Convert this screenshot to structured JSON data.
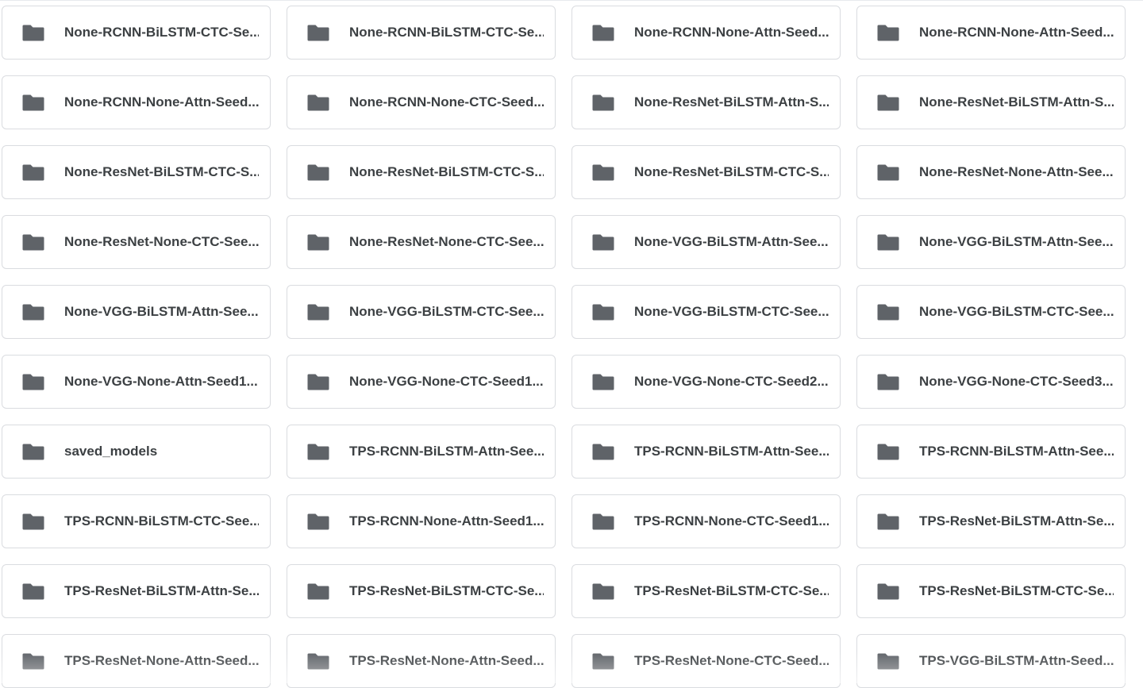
{
  "colors": {
    "folder_icon": "#5f6368",
    "text": "#3c4043",
    "card_border": "#dadce0",
    "background": "#ffffff"
  },
  "folders": [
    {
      "name": "None-RCNN-BiLSTM-CTC-Se...",
      "icon": "folder-icon"
    },
    {
      "name": "None-RCNN-BiLSTM-CTC-Se...",
      "icon": "folder-icon"
    },
    {
      "name": "None-RCNN-None-Attn-Seed...",
      "icon": "folder-icon"
    },
    {
      "name": "None-RCNN-None-Attn-Seed...",
      "icon": "folder-icon"
    },
    {
      "name": "None-RCNN-None-Attn-Seed...",
      "icon": "folder-icon"
    },
    {
      "name": "None-RCNN-None-CTC-Seed...",
      "icon": "folder-icon"
    },
    {
      "name": "None-ResNet-BiLSTM-Attn-S...",
      "icon": "folder-icon"
    },
    {
      "name": "None-ResNet-BiLSTM-Attn-S...",
      "icon": "folder-icon"
    },
    {
      "name": "None-ResNet-BiLSTM-CTC-S...",
      "icon": "folder-icon"
    },
    {
      "name": "None-ResNet-BiLSTM-CTC-S...",
      "icon": "folder-icon"
    },
    {
      "name": "None-ResNet-BiLSTM-CTC-S...",
      "icon": "folder-icon"
    },
    {
      "name": "None-ResNet-None-Attn-See...",
      "icon": "folder-icon"
    },
    {
      "name": "None-ResNet-None-CTC-See...",
      "icon": "folder-icon"
    },
    {
      "name": "None-ResNet-None-CTC-See...",
      "icon": "folder-icon"
    },
    {
      "name": "None-VGG-BiLSTM-Attn-See...",
      "icon": "folder-icon"
    },
    {
      "name": "None-VGG-BiLSTM-Attn-See...",
      "icon": "folder-icon"
    },
    {
      "name": "None-VGG-BiLSTM-Attn-See...",
      "icon": "folder-icon"
    },
    {
      "name": "None-VGG-BiLSTM-CTC-See...",
      "icon": "folder-icon"
    },
    {
      "name": "None-VGG-BiLSTM-CTC-See...",
      "icon": "folder-icon"
    },
    {
      "name": "None-VGG-BiLSTM-CTC-See...",
      "icon": "folder-icon"
    },
    {
      "name": "None-VGG-None-Attn-Seed1...",
      "icon": "folder-icon"
    },
    {
      "name": "None-VGG-None-CTC-Seed1...",
      "icon": "folder-icon"
    },
    {
      "name": "None-VGG-None-CTC-Seed2...",
      "icon": "folder-icon"
    },
    {
      "name": "None-VGG-None-CTC-Seed3...",
      "icon": "folder-icon"
    },
    {
      "name": "saved_models",
      "icon": "folder-icon"
    },
    {
      "name": "TPS-RCNN-BiLSTM-Attn-See...",
      "icon": "folder-icon"
    },
    {
      "name": "TPS-RCNN-BiLSTM-Attn-See...",
      "icon": "folder-icon"
    },
    {
      "name": "TPS-RCNN-BiLSTM-Attn-See...",
      "icon": "folder-icon"
    },
    {
      "name": "TPS-RCNN-BiLSTM-CTC-See...",
      "icon": "folder-icon"
    },
    {
      "name": "TPS-RCNN-None-Attn-Seed1...",
      "icon": "folder-icon"
    },
    {
      "name": "TPS-RCNN-None-CTC-Seed1...",
      "icon": "folder-icon"
    },
    {
      "name": "TPS-ResNet-BiLSTM-Attn-Se...",
      "icon": "folder-icon"
    },
    {
      "name": "TPS-ResNet-BiLSTM-Attn-Se...",
      "icon": "folder-icon"
    },
    {
      "name": "TPS-ResNet-BiLSTM-CTC-Se...",
      "icon": "folder-icon"
    },
    {
      "name": "TPS-ResNet-BiLSTM-CTC-Se...",
      "icon": "folder-icon"
    },
    {
      "name": "TPS-ResNet-BiLSTM-CTC-Se...",
      "icon": "folder-icon"
    },
    {
      "name": "TPS-ResNet-None-Attn-Seed...",
      "icon": "folder-icon"
    },
    {
      "name": "TPS-ResNet-None-Attn-Seed...",
      "icon": "folder-icon"
    },
    {
      "name": "TPS-ResNet-None-CTC-Seed...",
      "icon": "folder-icon"
    },
    {
      "name": "TPS-VGG-BiLSTM-Attn-Seed...",
      "icon": "folder-icon"
    }
  ]
}
